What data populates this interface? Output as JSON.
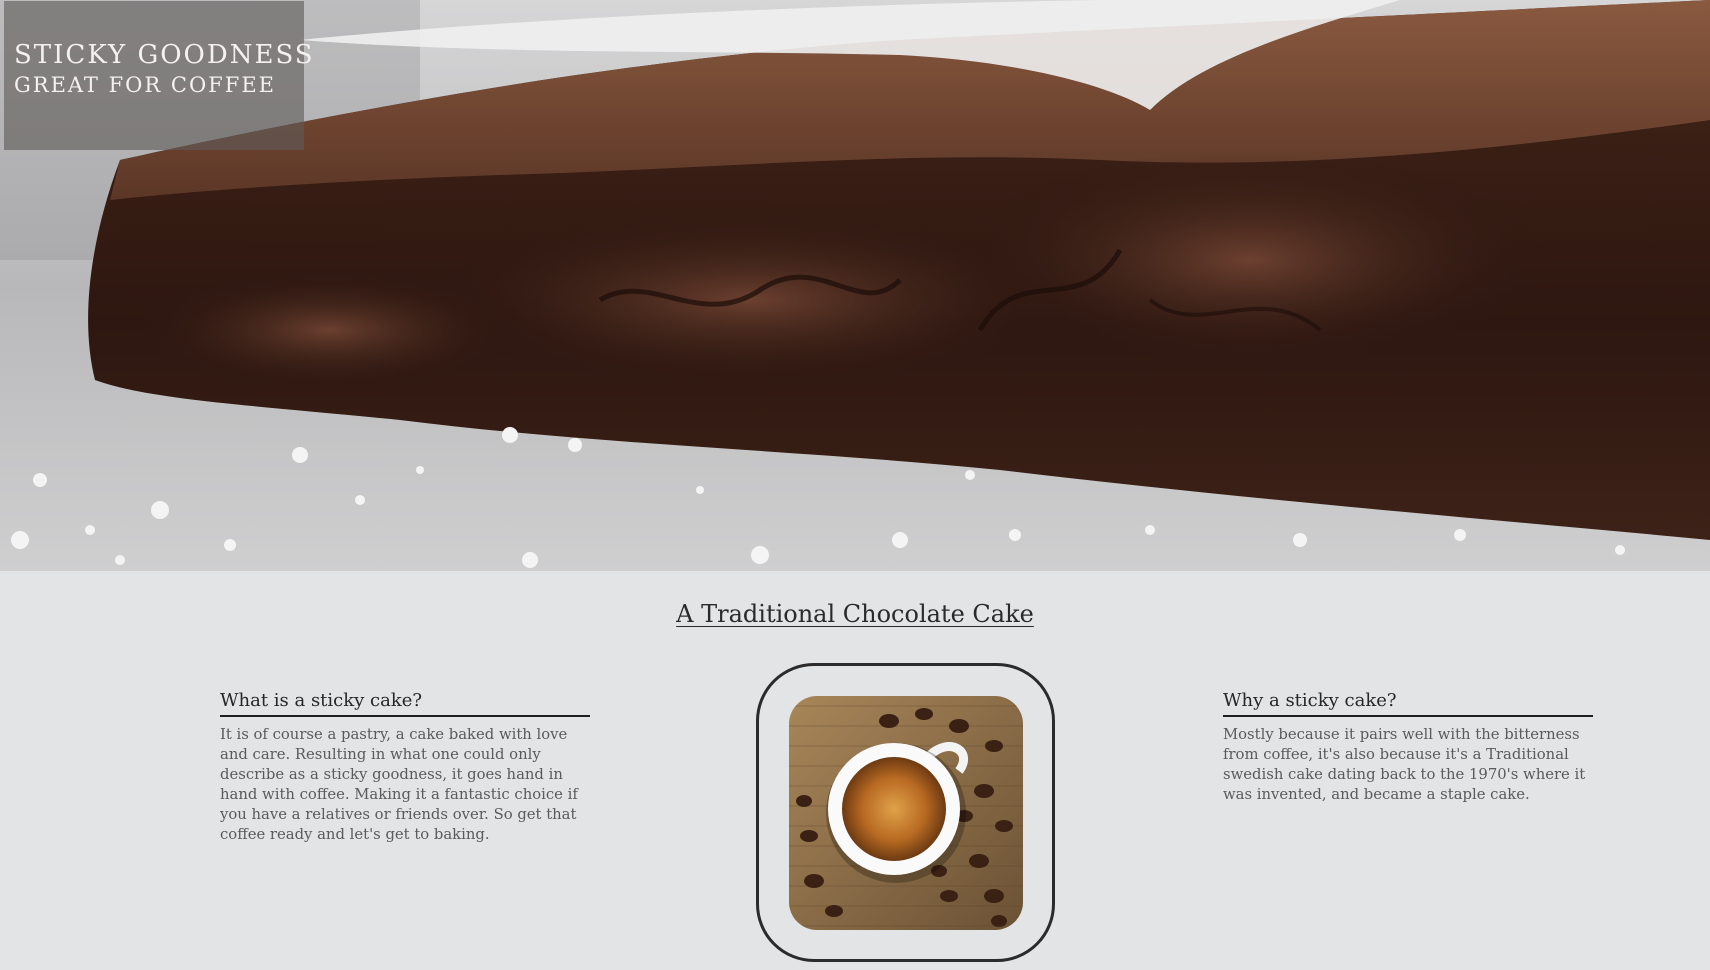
{
  "hero": {
    "title_line1": "STICKY GOODNESS",
    "title_line2": "GREAT FOR COFFEE"
  },
  "section": {
    "title": "A Traditional Chocolate Cake"
  },
  "left_column": {
    "heading": "What is a sticky cake?",
    "body": "It is of course a pastry, a cake baked with love and care. Resulting in what one could only describe as a sticky goodness, it goes hand in hand with coffee. Making it a fantastic choice if you have a relatives or friends over. So get that coffee ready and let's get to baking."
  },
  "right_column": {
    "heading": "Why a sticky cake?",
    "body": "Mostly because it pairs well with the bitterness from coffee, it's also because it's a Traditional swedish cake dating back to the 1970's where it was invented, and became a staple cake."
  },
  "colors": {
    "page_background": "#e3e4e6",
    "cake_dark": "#2a1610",
    "cake_mid": "#4a2a1e",
    "sugar": "#f2f2f2"
  }
}
